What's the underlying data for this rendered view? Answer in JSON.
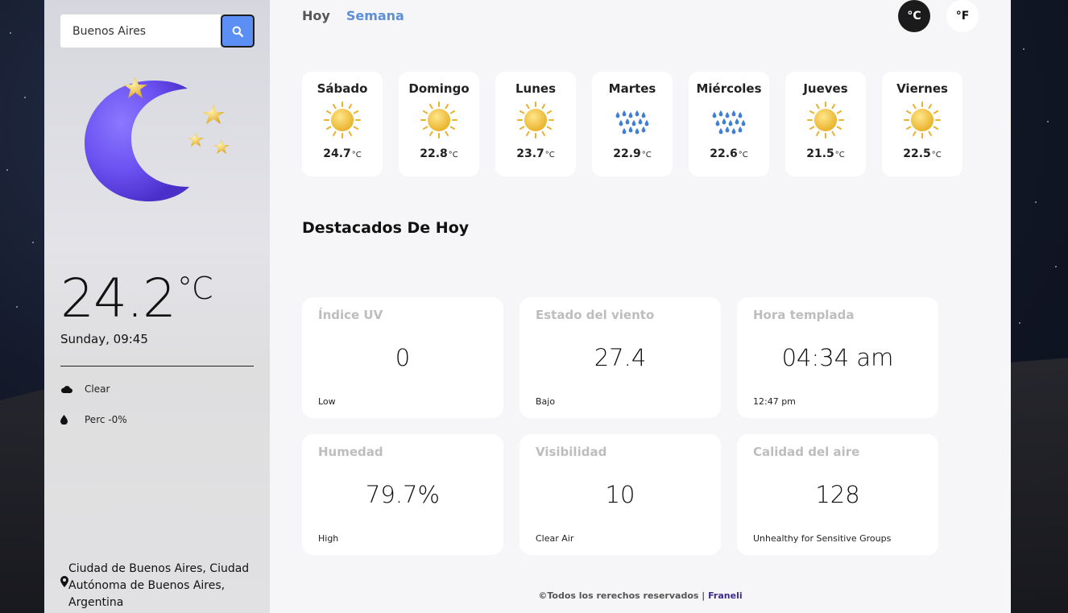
{
  "search": {
    "value": "Buenos Aires"
  },
  "current": {
    "temperature": "24.2",
    "unit": "°C",
    "datetime": "Sunday, 09:45",
    "condition": "Clear",
    "precipitation": "Perc -0%",
    "location": "Ciudad de Buenos Aires, Ciudad Autónoma de Buenos Aires, Argentina"
  },
  "tabs": [
    {
      "label": "Hoy"
    },
    {
      "label": "Semana"
    }
  ],
  "units": {
    "celsius": "°C",
    "fahrenheit": "°F"
  },
  "week": [
    {
      "day": "Sábado",
      "temp": "24.7",
      "unit": "°C",
      "icon": "sun-icon"
    },
    {
      "day": "Domingo",
      "temp": "22.8",
      "unit": "°C",
      "icon": "sun-icon"
    },
    {
      "day": "Lunes",
      "temp": "23.7",
      "unit": "°C",
      "icon": "sun-icon"
    },
    {
      "day": "Martes",
      "temp": "22.9",
      "unit": "°C",
      "icon": "rain-icon"
    },
    {
      "day": "Miércoles",
      "temp": "22.6",
      "unit": "°C",
      "icon": "rain-icon"
    },
    {
      "day": "Jueves",
      "temp": "21.5",
      "unit": "°C",
      "icon": "sun-icon"
    },
    {
      "day": "Viernes",
      "temp": "22.5",
      "unit": "°C",
      "icon": "sun-icon"
    }
  ],
  "highlights": {
    "title": "Destacados De Hoy",
    "cards": [
      {
        "title": "Índice UV",
        "value": "0",
        "sub": "Low"
      },
      {
        "title": "Estado del viento",
        "value": "27.4",
        "sub": "Bajo"
      },
      {
        "title": "Hora templada",
        "value": "04:34 am",
        "sub": "12:47 pm"
      },
      {
        "title": "Humedad",
        "value": "79.7%",
        "sub": "High"
      },
      {
        "title": "Visibilidad",
        "value": "10",
        "sub": "Clear Air"
      },
      {
        "title": "Calidad del aire",
        "value": "128",
        "sub": "Unhealthy for Sensitive Groups"
      }
    ]
  },
  "footer": {
    "text": "©Todos los rerechos reservados | ",
    "author": "Franeli"
  },
  "colors": {
    "accent": "#5b8ff3",
    "tab_active": "#5b8fd8",
    "moon": "#6a4ff0"
  }
}
